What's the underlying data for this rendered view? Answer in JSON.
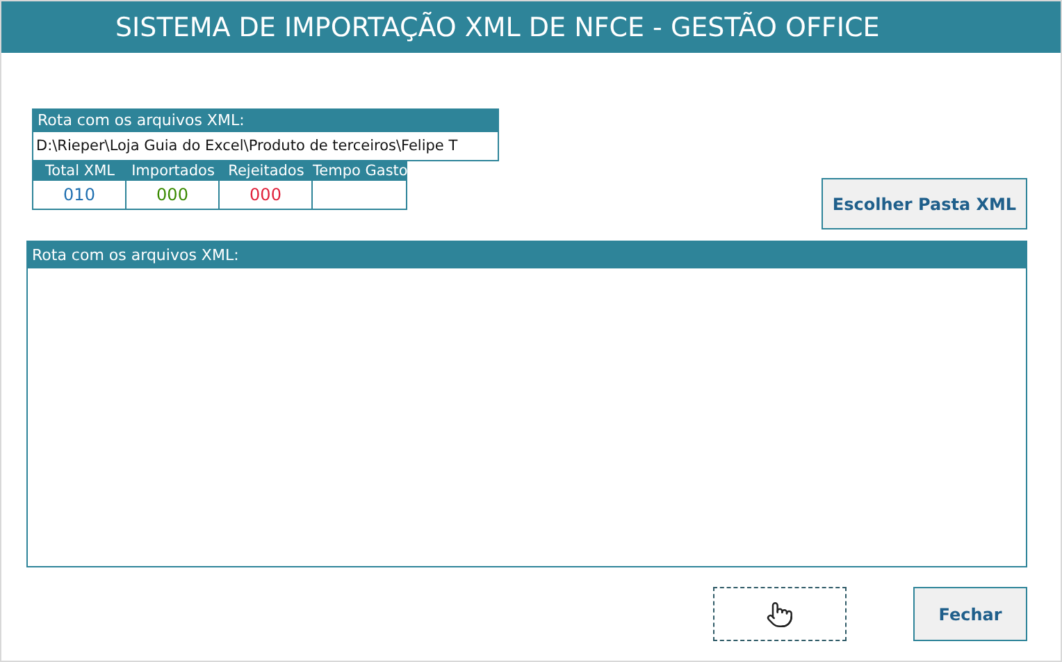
{
  "window": {
    "title": "SISTEMA DE IMPORTAÇÃO XML DE NFCE - GESTÃO OFFICE"
  },
  "route": {
    "label": "Rota com os arquivos XML:",
    "value": "D:\\Rieper\\Loja Guia do Excel\\Produto de terceiros\\Felipe T"
  },
  "stats": [
    {
      "label": "Total XML",
      "value": "010",
      "color": "#1f6fb0"
    },
    {
      "label": "Importados",
      "value": "000",
      "color": "#3a8a00"
    },
    {
      "label": "Rejeitados",
      "value": "000",
      "color": "#e0203a"
    },
    {
      "label": "Tempo Gasto"
    }
  ],
  "choose_button": "Escolher Pasta XML",
  "log": {
    "label": "Rota com os arquivos XML:"
  },
  "close_button": "Fechar"
}
